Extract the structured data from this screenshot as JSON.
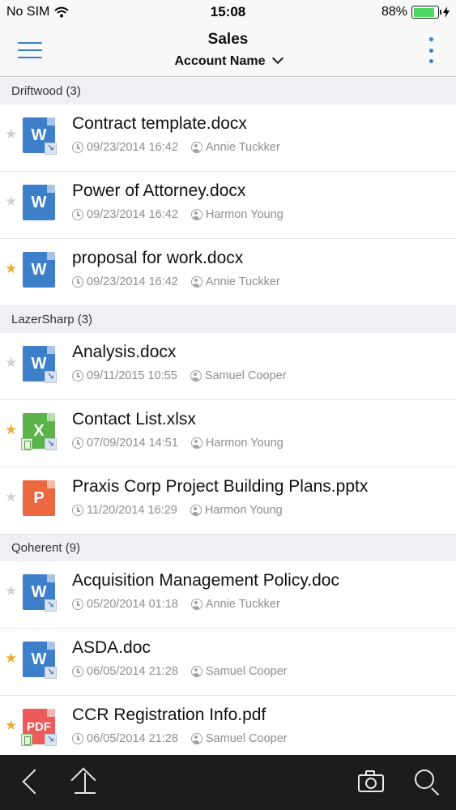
{
  "status_bar": {
    "carrier": "No SIM",
    "time": "15:08",
    "battery": "88%",
    "battery_level": 0.88,
    "icons": [
      "wifi-icon",
      "battery-icon",
      "charging-icon"
    ]
  },
  "header": {
    "title": "Sales",
    "subtitle": "Account Name",
    "icons": [
      "hamburger-menu-icon",
      "chevron-down-icon",
      "kebab-menu-icon"
    ]
  },
  "groups": [
    {
      "label": "Driftwood (3)",
      "items": [
        {
          "name": "Contract template.docx",
          "date": "09/23/2014 16:42",
          "user": "Annie Tuckker",
          "starred": false,
          "type": "W"
        },
        {
          "name": "Power of Attorney.docx",
          "date": "09/23/2014 16:42",
          "user": "Harmon Young",
          "starred": false,
          "type": "W"
        },
        {
          "name": "proposal for work.docx",
          "date": "09/23/2014 16:42",
          "user": "Annie Tuckker",
          "starred": true,
          "type": "W"
        }
      ]
    },
    {
      "label": "LazerSharp (3)",
      "items": [
        {
          "name": "Analysis.docx",
          "date": "09/11/2015 10:55",
          "user": "Samuel Cooper",
          "starred": false,
          "type": "W"
        },
        {
          "name": "Contact List.xlsx",
          "date": "07/09/2014 14:51",
          "user": "Harmon Young",
          "starred": true,
          "type": "X"
        },
        {
          "name": "Praxis Corp Project Building Plans.pptx",
          "date": "11/20/2014 16:29",
          "user": "Harmon Young",
          "starred": false,
          "type": "P"
        }
      ]
    },
    {
      "label": "Qoherent (9)",
      "items": [
        {
          "name": "Acquisition Management Policy.doc",
          "date": "05/20/2014 01:18",
          "user": "Annie Tuckker",
          "starred": false,
          "type": "W"
        },
        {
          "name": "ASDA.doc",
          "date": "06/05/2014 21:28",
          "user": "Samuel Cooper",
          "starred": true,
          "type": "W"
        },
        {
          "name": "CCR Registration Info.pdf",
          "date": "06/05/2014 21:28",
          "user": "Samuel Cooper",
          "starred": true,
          "type": "PDF"
        }
      ]
    }
  ],
  "toolbar": {
    "icons": [
      "back-icon",
      "upload-icon",
      "camera-icon",
      "search-icon"
    ]
  },
  "colors": {
    "accent": "#3a7ec4",
    "star_on": "#f0a830",
    "word": "#3d7fc8",
    "excel": "#5bb34a",
    "ppt": "#ec6840",
    "pdf": "#ec5a5a"
  }
}
